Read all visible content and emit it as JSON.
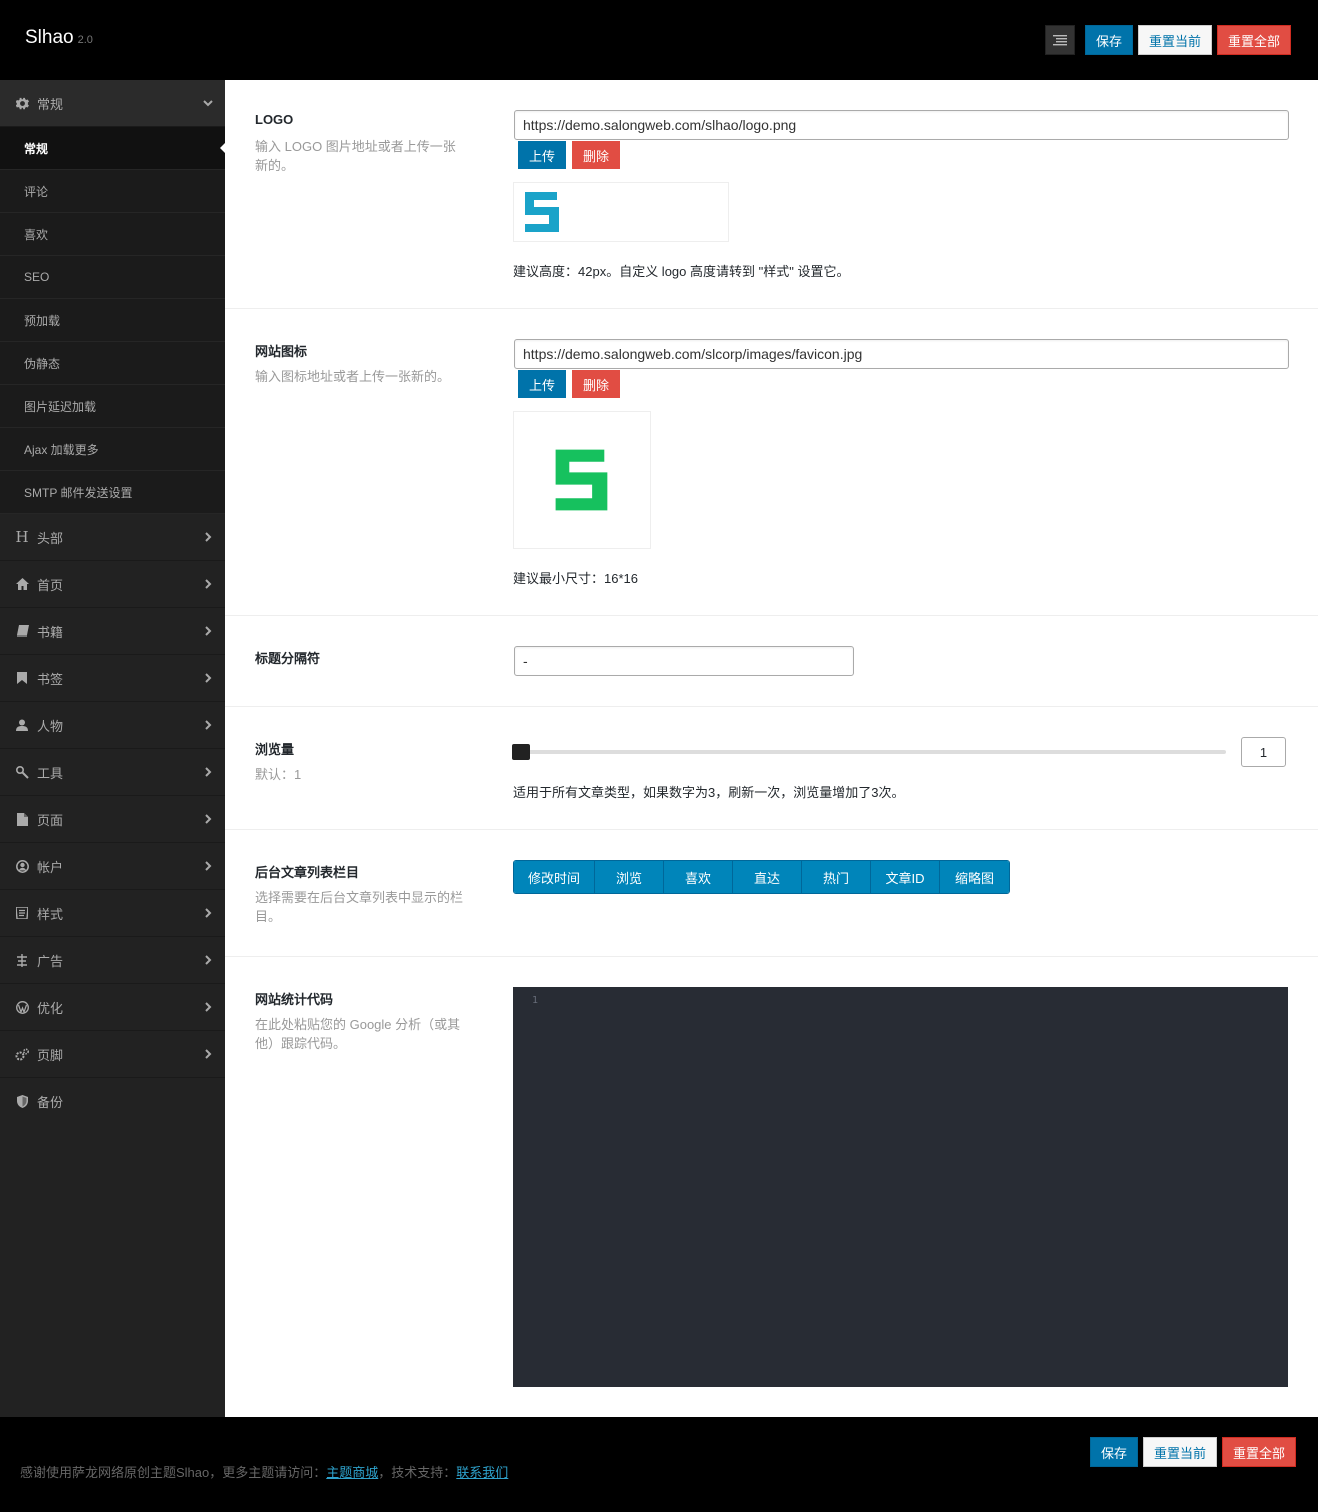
{
  "header": {
    "brand": "Slhao",
    "version": "2.0",
    "save_label": "保存",
    "reset_current_label": "重置当前",
    "reset_all_label": "重置全部"
  },
  "sidebar": {
    "general": {
      "label": "常规",
      "items": [
        "常规",
        "评论",
        "喜欢",
        "SEO",
        "预加载",
        "伪静态",
        "图片延迟加载",
        "Ajax 加载更多",
        "SMTP 邮件发送设置"
      ]
    },
    "sections": [
      {
        "label": "头部",
        "icon": "header-icon"
      },
      {
        "label": "首页",
        "icon": "home-icon"
      },
      {
        "label": "书籍",
        "icon": "book-icon"
      },
      {
        "label": "书签",
        "icon": "bookmark-icon"
      },
      {
        "label": "人物",
        "icon": "user-icon"
      },
      {
        "label": "工具",
        "icon": "wrench-icon"
      },
      {
        "label": "页面",
        "icon": "file-icon"
      },
      {
        "label": "帐户",
        "icon": "account-icon"
      },
      {
        "label": "样式",
        "icon": "css-icon"
      },
      {
        "label": "广告",
        "icon": "ad-icon"
      },
      {
        "label": "优化",
        "icon": "wordpress-icon"
      },
      {
        "label": "页脚",
        "icon": "cogs-icon"
      }
    ],
    "backup": {
      "label": "备份",
      "icon": "shield-icon"
    }
  },
  "fields": {
    "logo": {
      "title": "LOGO",
      "desc": "输入 LOGO 图片地址或者上传一张新的。",
      "value": "https://demo.salongweb.com/slhao/logo.png",
      "upload_label": "上传",
      "delete_label": "删除",
      "note": "建议高度：42px。自定义 logo 高度请转到 \"样式\" 设置它。"
    },
    "favicon": {
      "title": "网站图标",
      "desc": "输入图标地址或者上传一张新的。",
      "value": "https://demo.salongweb.com/slcorp/images/favicon.jpg",
      "upload_label": "上传",
      "delete_label": "删除",
      "note": "建议最小尺寸：16*16"
    },
    "separator": {
      "title": "标题分隔符",
      "value": "-"
    },
    "views": {
      "title": "浏览量",
      "desc": "默认：1",
      "value": "1",
      "note": "适用于所有文章类型，如果数字为3，刷新一次，浏览量增加了3次。"
    },
    "columns": {
      "title": "后台文章列表栏目",
      "desc": "选择需要在后台文章列表中显示的栏目。",
      "options": [
        "修改时间",
        "浏览",
        "喜欢",
        "直达",
        "热门",
        "文章ID",
        "缩略图"
      ]
    },
    "analytics": {
      "title": "网站统计代码",
      "desc": "在此处粘贴您的 Google 分析（或其他）跟踪代码。",
      "line_number": "1"
    }
  },
  "footer": {
    "text_prefix": "感谢使用萨龙网络原创主题Slhao，更多主题请访问：",
    "link1": "主题商城",
    "text_middle": "，技术支持：",
    "link2": "联系我们",
    "save_label": "保存",
    "reset_current_label": "重置当前",
    "reset_all_label": "重置全部"
  },
  "colors": {
    "logo_cyan": "#1aa3c9",
    "favicon_green": "#16c15e",
    "primary": "#0085ba",
    "danger": "#e14d43"
  }
}
